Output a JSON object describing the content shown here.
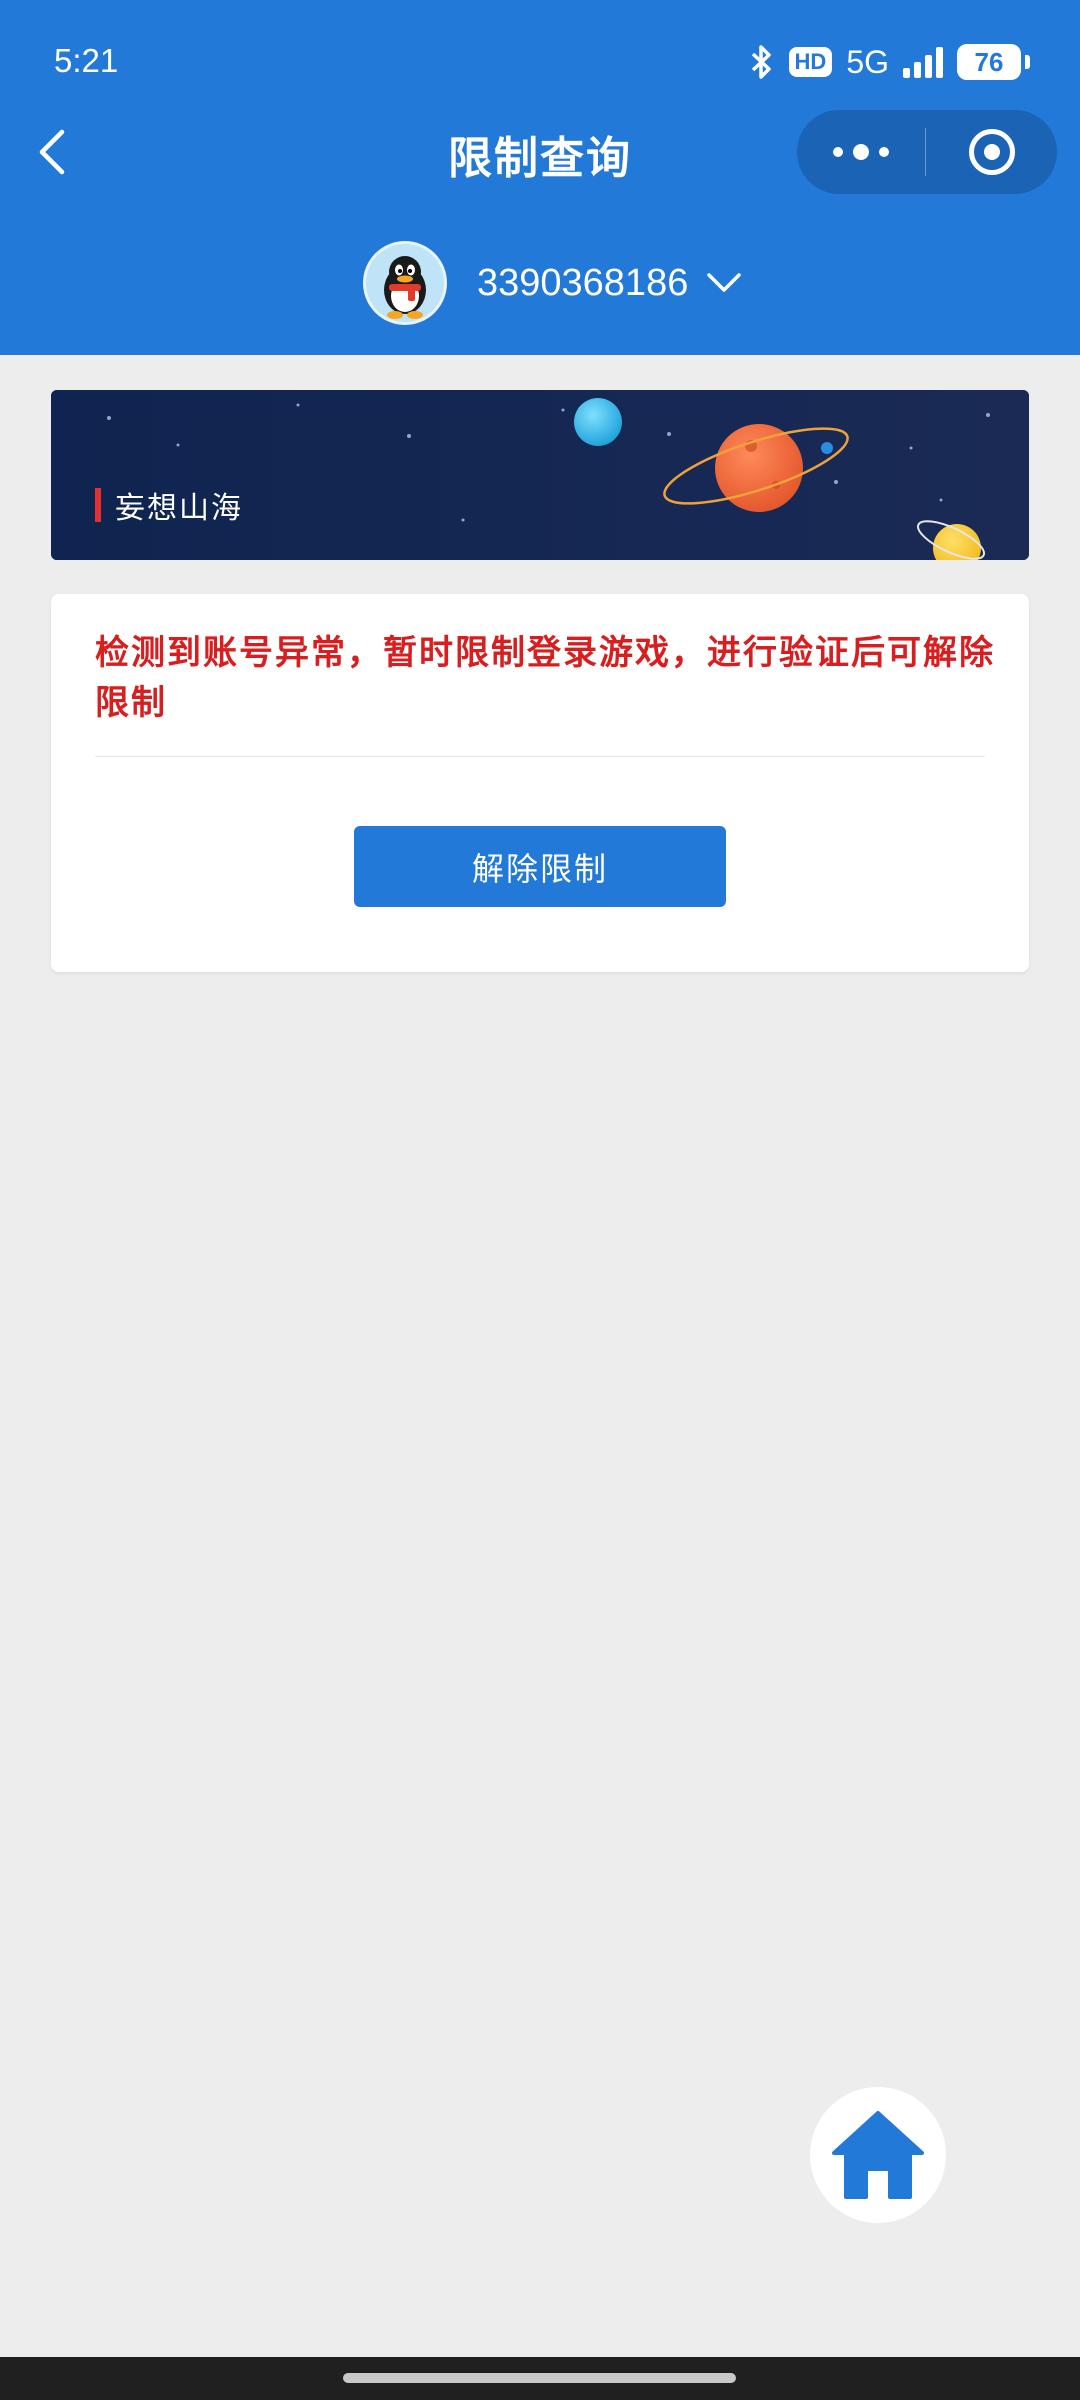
{
  "status_bar": {
    "time": "5:21",
    "hd": "HD",
    "network": "5G",
    "battery": "76"
  },
  "nav": {
    "title": "限制查询"
  },
  "account": {
    "number": "3390368186"
  },
  "banner": {
    "label": "妄想山海"
  },
  "card": {
    "warning": "检测到账号异常，暂时限制登录游戏，进行验证后可解除限制",
    "button_label": "解除限制"
  },
  "colors": {
    "primary": "#2279d8",
    "warning": "#d81e1e",
    "background": "#ededed"
  },
  "icons": [
    "bluetooth-icon",
    "signal-icon",
    "battery-icon",
    "back-arrow-icon",
    "more-icon",
    "target-icon",
    "qq-penguin-avatar",
    "chevron-down-icon",
    "home-icon"
  ]
}
